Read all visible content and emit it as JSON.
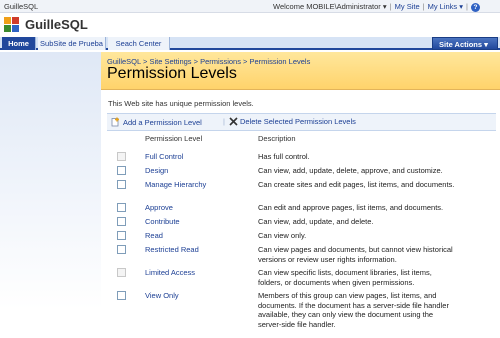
{
  "global": {
    "site_name": "GuilleSQL",
    "welcome": "Welcome MOBILE\\Administrator",
    "my_site": "My Site",
    "my_links": "My Links"
  },
  "header": {
    "title": "GuilleSQL"
  },
  "tabs": [
    {
      "label": "Home"
    },
    {
      "label": "SubSite de Prueba"
    },
    {
      "label": "Seach Center"
    }
  ],
  "site_actions": {
    "label": "Site Actions"
  },
  "breadcrumb": "GuilleSQL > Site Settings > Permissions > Permission Levels",
  "page_title": "Permission Levels",
  "unique_message": "This Web site has unique permission levels.",
  "toolbar": {
    "add_label": "Add a Permission Level",
    "delete_label": "Delete Selected Permission Levels"
  },
  "table": {
    "headers": {
      "level": "Permission Level",
      "description": "Description"
    },
    "rows": [
      {
        "name": "Full Control",
        "description": "Has full control."
      },
      {
        "name": "Design",
        "description": "Can view, add, update, delete, approve, and customize."
      },
      {
        "name": "Manage Hierarchy",
        "description": "Can create sites and edit pages, list items, and documents."
      },
      {
        "name": "Approve",
        "description": "Can edit and approve pages, list items, and documents."
      },
      {
        "name": "Contribute",
        "description": "Can view, add, update, and delete."
      },
      {
        "name": "Read",
        "description": "Can view only."
      },
      {
        "name": "Restricted Read",
        "description": "Can view pages and documents, but cannot view historical versions or review user rights information."
      },
      {
        "name": "Limited Access",
        "description": "Can view specific lists, document libraries, list items, folders, or documents when given permissions."
      },
      {
        "name": "View Only",
        "description": "Members of this group can view pages, list items, and documents. If the document has a server-side file handler available, they can only view the document using the server-side file handler."
      }
    ]
  },
  "colors": {
    "accent": "#21489c",
    "header_yellow": "#ffd36b",
    "link": "#1c3f94"
  }
}
